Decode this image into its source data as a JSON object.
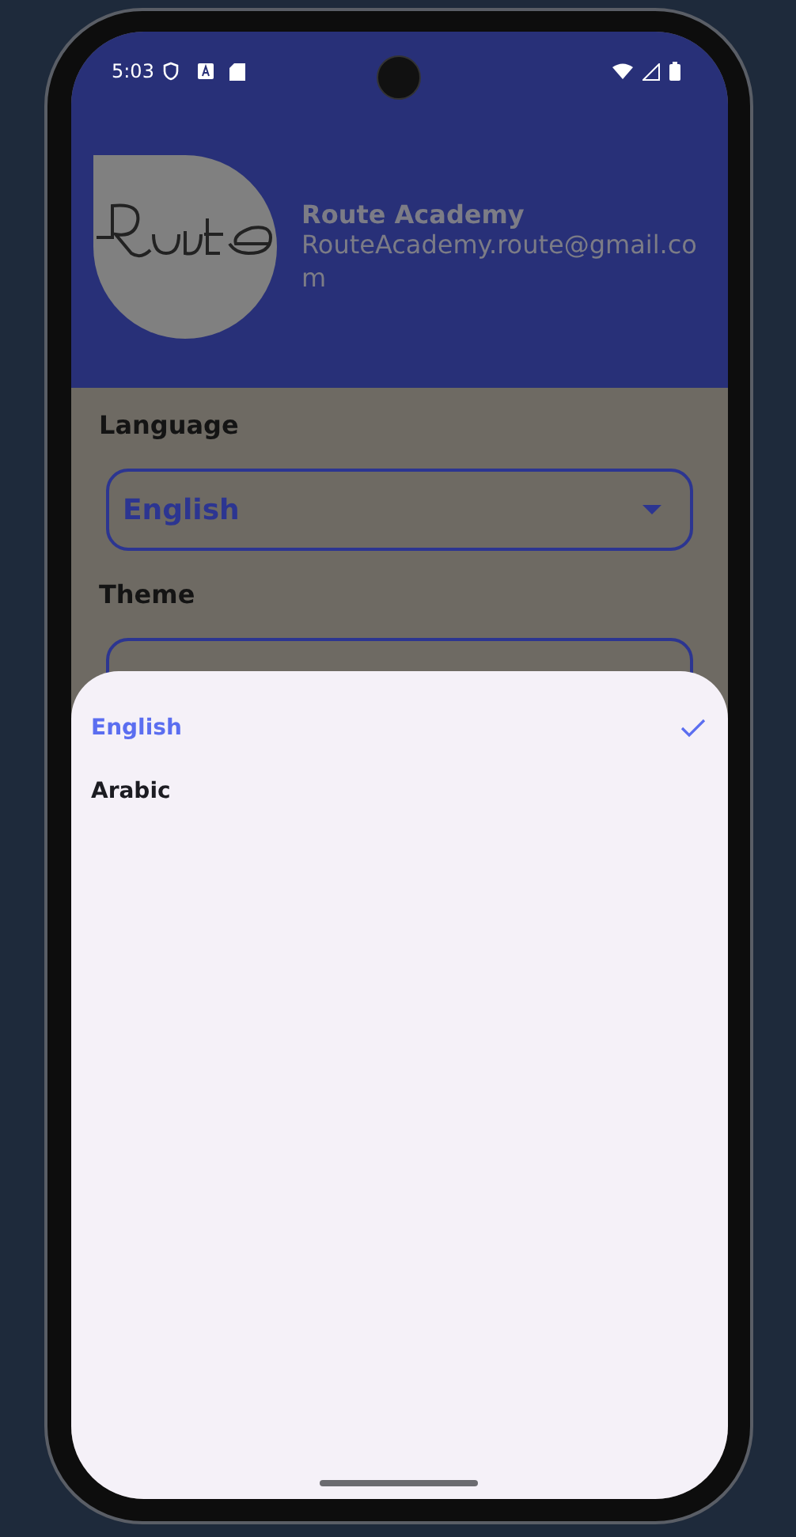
{
  "status_bar": {
    "time": "5:03"
  },
  "profile": {
    "name": "Route Academy",
    "email": "RouteAcademy.route@gmail.com"
  },
  "settings": [
    {
      "label": "Language",
      "value": "English"
    },
    {
      "label": "Theme"
    }
  ],
  "sheet": {
    "options": [
      {
        "label": "English",
        "selected": true
      },
      {
        "label": "Arabic",
        "selected": false
      }
    ]
  }
}
